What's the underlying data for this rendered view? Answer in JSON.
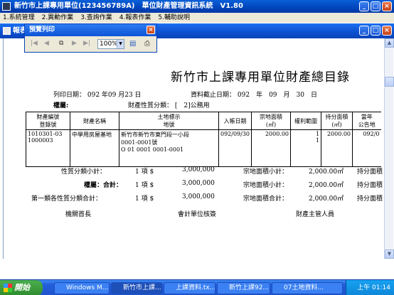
{
  "app": {
    "title": "新竹市上課專用單位(123456789A)　單位財產管理資訊系統　V1.80",
    "menu": [
      "1.系統管理",
      "2.異動作業",
      "3.查詢作業",
      "4.報表作業",
      "5.輔助說明"
    ]
  },
  "inner_window": {
    "title": "報表"
  },
  "preview_dialog": {
    "title": "預覽列印",
    "zoom": "100%",
    "nav_icons": [
      "first-page-icon",
      "prev-page-icon",
      "copy-icon",
      "next-page-icon",
      "last-page-icon"
    ]
  },
  "report": {
    "title": "新竹市上課專用單位財產總目錄",
    "print_date_label": "列印日期：",
    "print_date": "092 年09 月23 日",
    "cutoff_label": "資料截止日期：",
    "cutoff_date": "092　年　09　月　30　日",
    "rights_label": "權屬:",
    "category_label": "財產性質分類：",
    "category_value": "[　2]公務用",
    "columns": {
      "c1": [
        "財產編號",
        "登錄號"
      ],
      "c2": "財產名稱",
      "c3": [
        "土地標示",
        "地號"
      ],
      "c4": "入帳日期",
      "c5": [
        "宗地面積",
        "(㎡)"
      ],
      "c6": "權利範圍",
      "c7": [
        "持分面積",
        "(㎡)"
      ],
      "c8": [
        "當年",
        "公告地"
      ]
    },
    "row": {
      "id": "1010301-03",
      "reg": "1000003",
      "name": "中學用房屋基地",
      "land1": "新竹市新竹市東門段一小段",
      "land2": "0001-0001號",
      "land3": "O 01 0001 0001-0001",
      "date": "092/09/30",
      "area": "2000.00",
      "rights1": "1",
      "rights2": "1",
      "share_area": "2000.00",
      "ann": "092/0"
    },
    "summaries": [
      {
        "label": "性質分類小計：",
        "count": "1 項 $",
        "amount": "3,000,000",
        "area_label": "宗地面積小計：",
        "area": "2,000.00㎡",
        "share_label": "持分面積"
      },
      {
        "label": "權屬：合計：",
        "count": "1 項 $",
        "amount": "3,000,000",
        "area_label": "宗地面積小計：",
        "area": "2,000.00㎡",
        "share_label": "持分面積"
      },
      {
        "label": "第一類各性質分類合計：",
        "count": "1 項 $",
        "amount": "3,000,000",
        "area_label": "宗地面積合計：",
        "area": "2,000.00㎡",
        "share_label": "持分面積"
      }
    ],
    "signatures": [
      "機關首長",
      "會計單位核簽",
      "財產主管人員"
    ]
  },
  "taskbar": {
    "start": "開始",
    "tasks": [
      "Windows M...",
      "新竹市上課...",
      "上課資料.tx...",
      "新竹上課92...",
      "07土地資料..."
    ],
    "clock": "上午 01:14"
  },
  "colors": {
    "titlebar": "#0044bb",
    "taskbar": "#245edb",
    "start": "#3a9d3a",
    "dialog_bg": "#ece9d8"
  }
}
